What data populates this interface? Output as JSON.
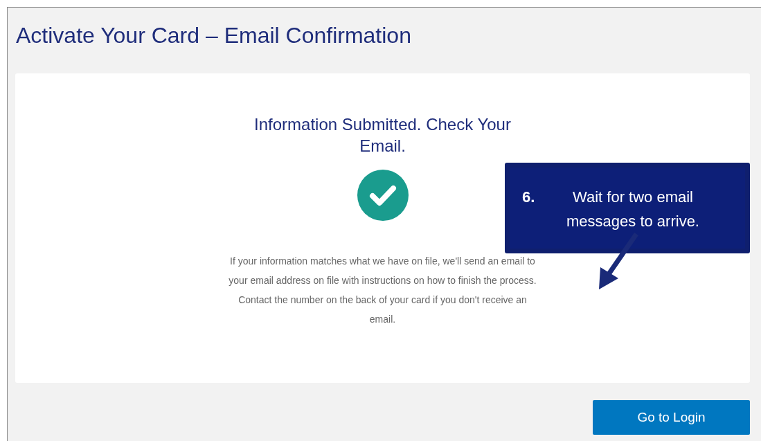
{
  "page": {
    "title": "Activate Your Card – Email Confirmation"
  },
  "confirmation": {
    "heading": "Information Submitted. Check Your Email.",
    "message": "If your information matches what we have on file, we'll send an email to your email address on file with instructions on how to finish the process. Contact the number on the back of your card if you don't receive an email."
  },
  "callout": {
    "step": "6.",
    "text": "Wait for two email messages to arrive."
  },
  "buttons": [
    "Go to Login"
  ]
}
